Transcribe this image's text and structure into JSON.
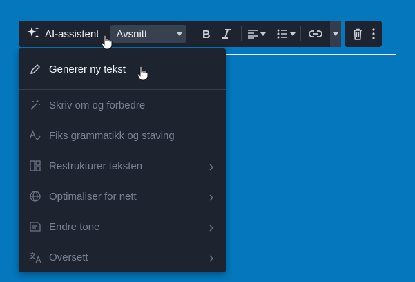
{
  "toolbar": {
    "ai_label": "AI-assistent",
    "paragraph_label": "Avsnitt"
  },
  "menu": {
    "items": [
      {
        "label": "Generer ny tekst",
        "icon": "pen-sparkle-icon",
        "enabled": true,
        "submenu": false
      },
      {
        "label": "Skriv om og forbedre",
        "icon": "magic-wand-icon",
        "enabled": false,
        "submenu": false
      },
      {
        "label": "Fiks grammatikk og staving",
        "icon": "spell-check-icon",
        "enabled": false,
        "submenu": false
      },
      {
        "label": "Restrukturer teksten",
        "icon": "layout-icon",
        "enabled": false,
        "submenu": true
      },
      {
        "label": "Optimaliser for nett",
        "icon": "globe-icon",
        "enabled": false,
        "submenu": true
      },
      {
        "label": "Endre tone",
        "icon": "tone-icon",
        "enabled": false,
        "submenu": true
      },
      {
        "label": "Oversett",
        "icon": "translate-icon",
        "enabled": false,
        "submenu": true
      }
    ]
  },
  "colors": {
    "background": "#0477bd",
    "toolbar": "#1e2330",
    "menu": "#1e2330",
    "text_active": "#f2f4f7",
    "text_disabled": "#7a8190"
  }
}
